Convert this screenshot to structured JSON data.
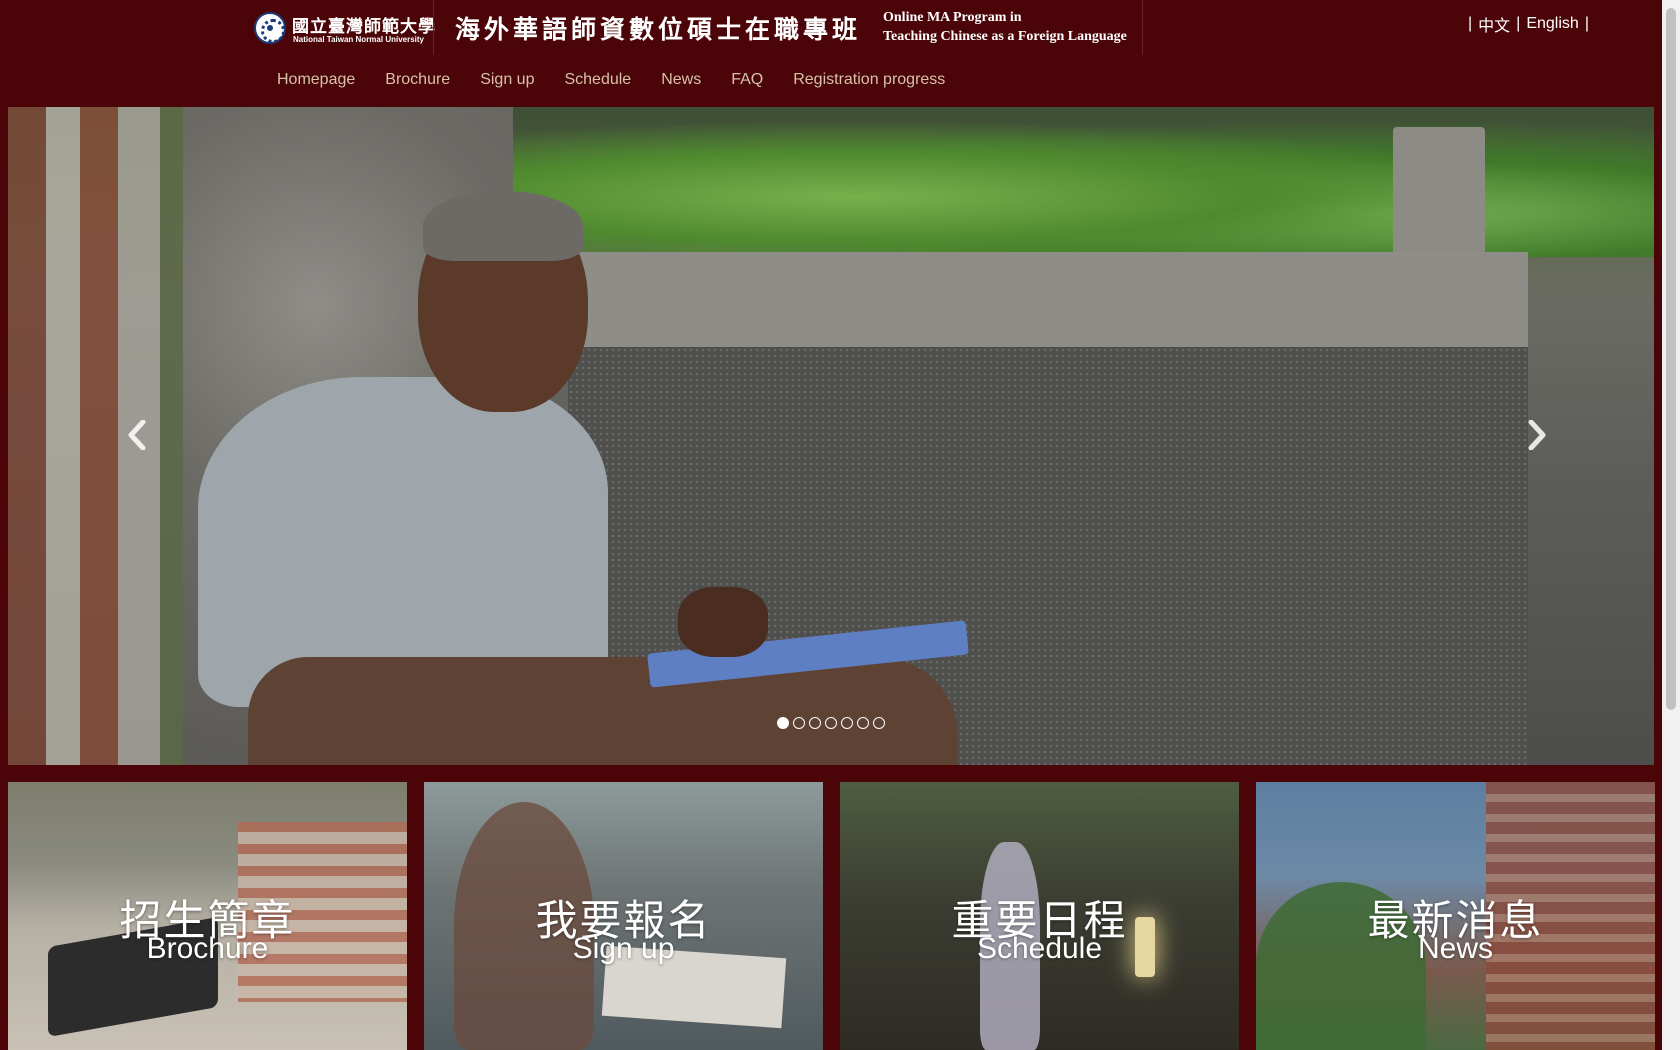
{
  "header": {
    "university_zh": "國立臺灣師範大學",
    "university_en": "National Taiwan Normal University",
    "program_zh": "海外華語師資數位碩士在職專班",
    "program_en_line1": "Online MA Program in",
    "program_en_line2": "Teaching Chinese as a Foreign Language"
  },
  "language_switcher": {
    "separator": "|",
    "chinese": "中文",
    "english": "English"
  },
  "nav": {
    "items": [
      {
        "label": "Homepage"
      },
      {
        "label": "Brochure"
      },
      {
        "label": "Sign up"
      },
      {
        "label": "Schedule"
      },
      {
        "label": "News"
      },
      {
        "label": "FAQ"
      },
      {
        "label": "Registration progress"
      }
    ]
  },
  "carousel": {
    "slide_count": 7,
    "active_slide": 1,
    "prev_icon": "chevron-left-icon",
    "next_icon": "chevron-right-icon"
  },
  "tiles": [
    {
      "zh": "招生簡章",
      "en": "Brochure"
    },
    {
      "zh": "我要報名",
      "en": "Sign up"
    },
    {
      "zh": "重要日程",
      "en": "Schedule"
    },
    {
      "zh": "最新消息",
      "en": "News"
    }
  ],
  "colors": {
    "brand_background": "#4b0508",
    "nav_text": "#d7c2a8"
  }
}
